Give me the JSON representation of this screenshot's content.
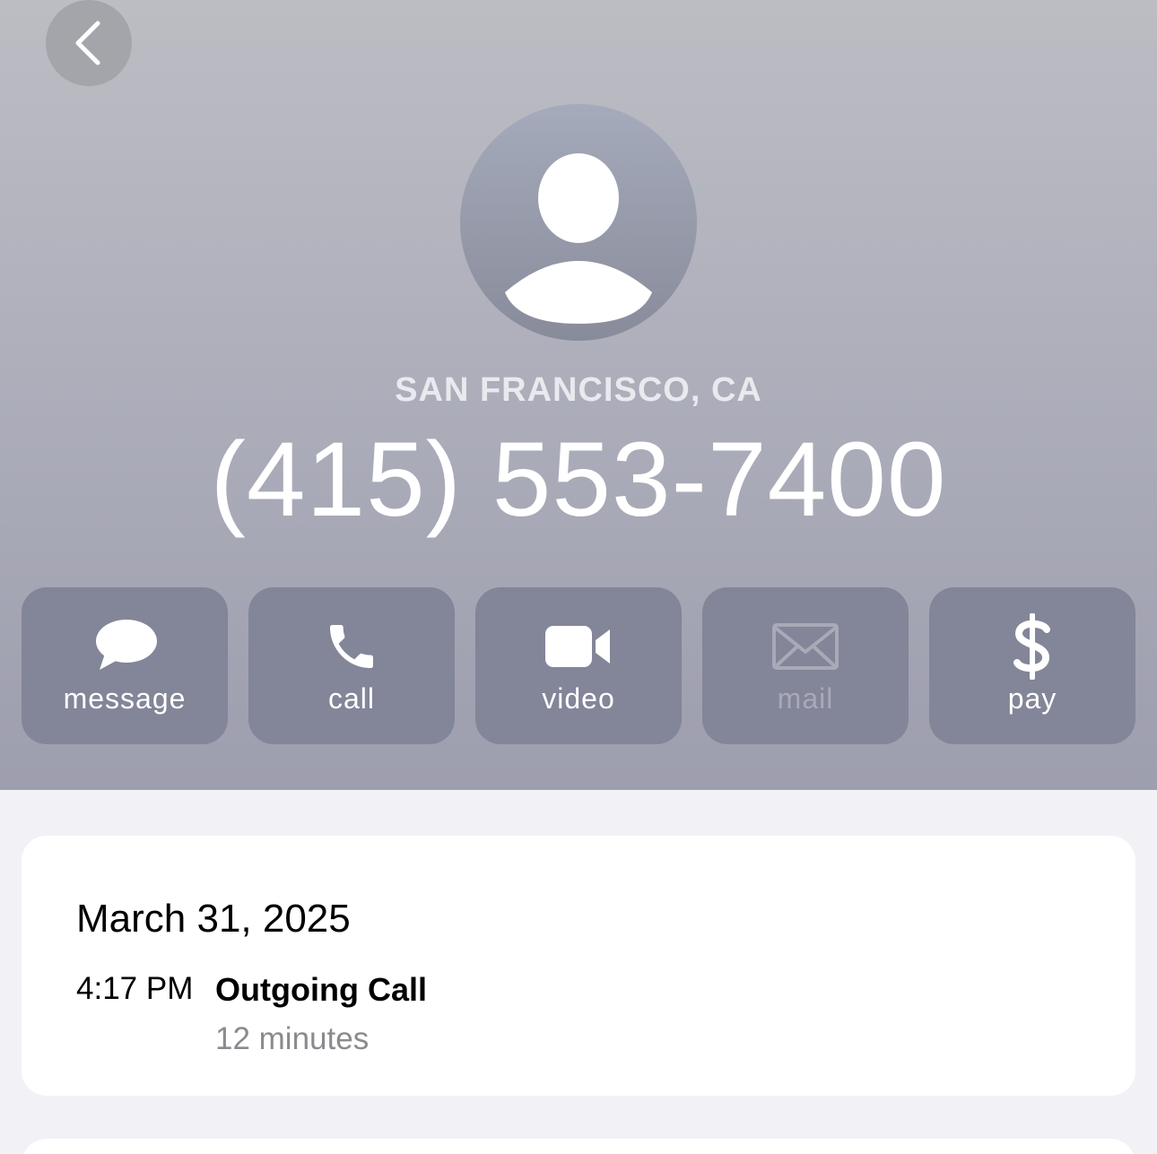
{
  "header": {
    "location": "SAN FRANCISCO, CA",
    "phone_number": "(415) 553-7400"
  },
  "actions": [
    {
      "label": "message",
      "icon": "message-bubble-icon",
      "enabled": true
    },
    {
      "label": "call",
      "icon": "phone-icon",
      "enabled": true
    },
    {
      "label": "video",
      "icon": "video-camera-icon",
      "enabled": true
    },
    {
      "label": "mail",
      "icon": "envelope-icon",
      "enabled": false
    },
    {
      "label": "pay",
      "icon": "dollar-icon",
      "enabled": true
    }
  ],
  "recent_call": {
    "date": "March 31, 2025",
    "time": "4:17 PM",
    "type": "Outgoing Call",
    "duration": "12 minutes"
  },
  "colors": {
    "header_top": "#bcbdc3",
    "header_bottom": "#9d9eae",
    "action_button": "#838598",
    "page_background": "#f2f1f6",
    "card_background": "#ffffff",
    "secondary_text": "#8a8a8f"
  }
}
